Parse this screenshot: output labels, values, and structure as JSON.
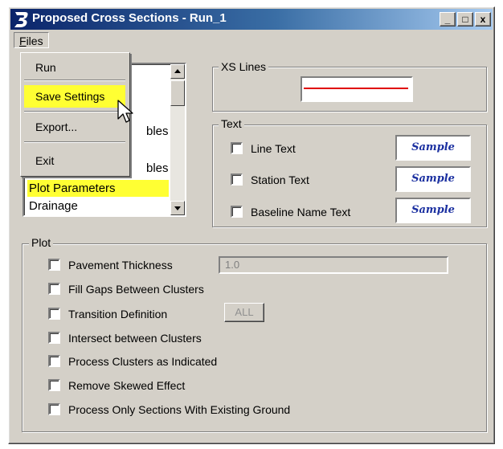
{
  "window": {
    "title": "Proposed Cross Sections - Run_1",
    "logo_icon": "bentley-b-icon",
    "caption_buttons": [
      "_",
      "□",
      "x"
    ]
  },
  "menubar": {
    "files_prefix": "F",
    "files_rest": "iles"
  },
  "file_menu": {
    "items": [
      {
        "label": "Run"
      },
      {
        "label": "Save Settings"
      },
      {
        "label": "Export..."
      },
      {
        "label": "Exit"
      }
    ],
    "highlighted": "Save Settings"
  },
  "list": {
    "visible_fragments": [
      "bles",
      "bles"
    ],
    "items": [
      {
        "label": "Plot Parameters",
        "selected": true
      },
      {
        "label": "Drainage",
        "selected": false
      }
    ]
  },
  "xs_lines": {
    "label": "XS Lines",
    "line_color": "#e00000"
  },
  "text_group": {
    "label": "Text",
    "rows": [
      {
        "label": "Line Text",
        "checked": false,
        "sample": "Sample"
      },
      {
        "label": "Station Text",
        "checked": false,
        "sample": "Sample"
      },
      {
        "label": "Baseline Name Text",
        "checked": false,
        "sample": "Sample"
      }
    ]
  },
  "plot_group": {
    "label": "Plot",
    "pavement_thickness_value": "1.0",
    "transition_button": "ALL",
    "options": [
      {
        "label": "Pavement Thickness",
        "checked": false
      },
      {
        "label": "Fill Gaps Between Clusters",
        "checked": false
      },
      {
        "label": "Transition Definition",
        "checked": false
      },
      {
        "label": "Intersect between Clusters",
        "checked": false
      },
      {
        "label": "Process Clusters as Indicated",
        "checked": false
      },
      {
        "label": "Remove Skewed Effect",
        "checked": false
      },
      {
        "label": "Process Only Sections With Existing Ground",
        "checked": false
      }
    ]
  },
  "colors": {
    "highlight": "#ffff33",
    "face": "#d4d0c8",
    "title_start": "#0a246a",
    "title_end": "#a6caf0"
  }
}
